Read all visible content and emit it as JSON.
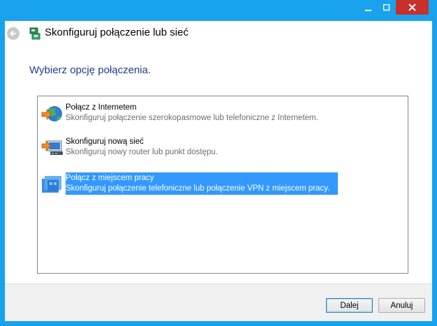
{
  "window": {
    "title": "Skonfiguruj połączenie lub sieć",
    "minimize_icon": "minimize-icon",
    "maximize_icon": "maximize-icon",
    "close_icon": "close-icon"
  },
  "header": {
    "back_icon": "back-arrow-icon",
    "app_icon": "network-setup-icon"
  },
  "section_title": "Wybierz opcję połączenia.",
  "options": [
    {
      "title": "Połącz z Internetem",
      "description": "Skonfiguruj połączenie szerokopasmowe lub telefoniczne z Internetem.",
      "icon": "globe-icon",
      "selected": false
    },
    {
      "title": "Skonfiguruj nową sieć",
      "description": "Skonfiguruj nowy router lub punkt dostępu.",
      "icon": "router-icon",
      "selected": false
    },
    {
      "title": "Połącz z miejscem pracy",
      "description": "Skonfiguruj połączenie telefoniczne lub połączenie VPN z miejscem pracy.",
      "icon": "workplace-icon",
      "selected": true
    }
  ],
  "buttons": {
    "next": "Dalej",
    "cancel": "Anuluj"
  },
  "colors": {
    "frame": "#17a2f0",
    "selection": "#3399ff",
    "title_blue": "#1f3b91",
    "close_red": "#c7302b"
  }
}
